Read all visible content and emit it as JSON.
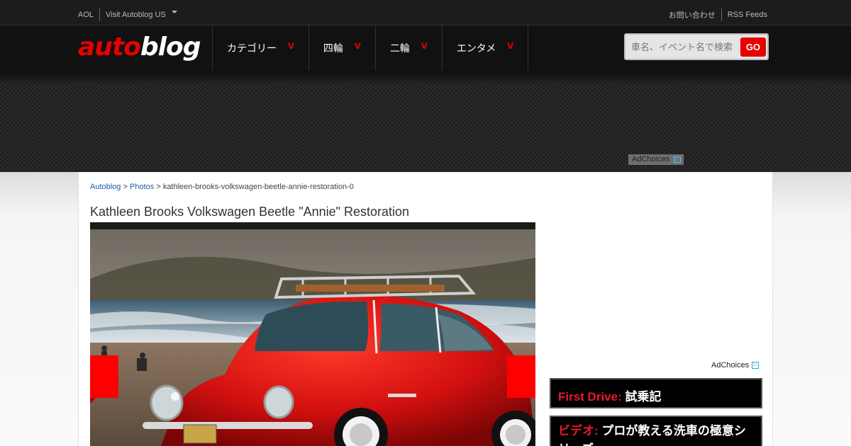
{
  "topbar": {
    "aol": "AOL",
    "visit_us": "Visit Autoblog US",
    "contact": "お問い合わせ",
    "rss": "RSS Feeds"
  },
  "header": {
    "logo_auto": "auto",
    "logo_blog": "blog",
    "nav": [
      {
        "label": "カテゴリー",
        "chevron": "v"
      },
      {
        "label": "四輪",
        "chevron": "v"
      },
      {
        "label": "二輪",
        "chevron": "v"
      },
      {
        "label": "エンタメ",
        "chevron": "v"
      }
    ],
    "search": {
      "placeholder": "車名、イベント名で検索",
      "button": "GO"
    }
  },
  "ad": {
    "adchoices": "AdChoices",
    "adchoices_icon": "adchoices-triangle-icon"
  },
  "breadcrumb": {
    "home": "Autoblog",
    "sep1": ">",
    "photos": "Photos",
    "sep2": ">",
    "current": "kathleen-brooks-volkswagen-beetle-annie-restoration-0"
  },
  "page": {
    "title": "Kathleen Brooks Volkswagen Beetle \"Annie\" Restoration"
  },
  "sidebar": {
    "adchoices": "AdChoices",
    "promos": [
      {
        "kicker": "First Drive:",
        "text": "試乗記"
      },
      {
        "kicker": "ビデオ:",
        "text": "プロが教える洗車の極意シリーズ"
      }
    ]
  },
  "colors": {
    "brand_red": "#e60000",
    "accent_red": "#e8192c",
    "link_blue": "#1a5ea8"
  }
}
